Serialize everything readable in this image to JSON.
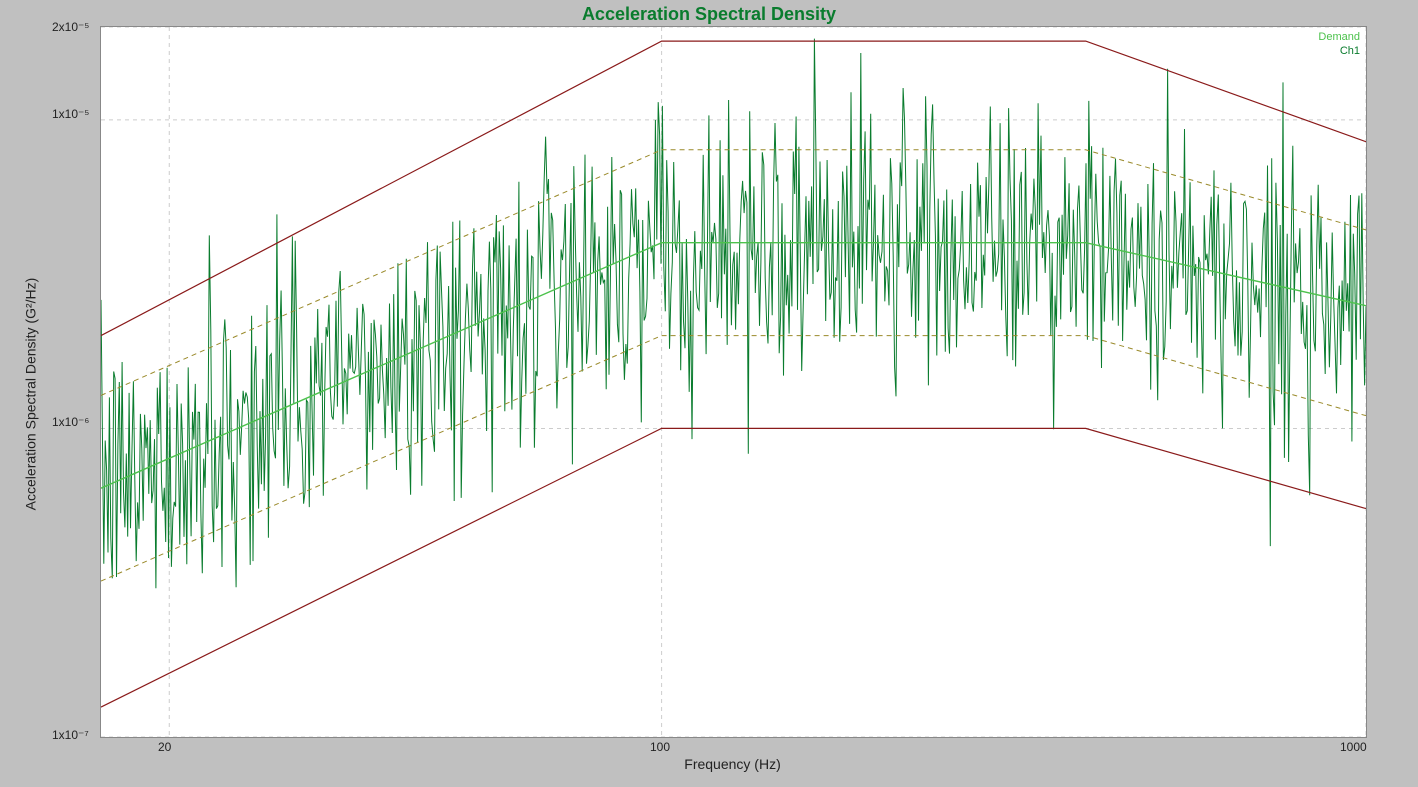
{
  "chart_data": {
    "type": "line",
    "title": "Acceleration Spectral Density",
    "xlabel": "Frequency (Hz)",
    "ylabel": "Acceleration Spectral Density (G²/Hz)",
    "x_scale": "log",
    "y_scale": "log",
    "xlim_hz": [
      16,
      1000
    ],
    "ylim_g2hz": [
      1e-07,
      2e-05
    ],
    "x_ticks": [
      20,
      100,
      1000
    ],
    "y_ticks": [
      1e-07,
      1e-06,
      1e-05,
      2e-05
    ],
    "y_tick_labels": [
      "1x10⁻⁷",
      "1x10⁻⁶",
      "1x10⁻⁵",
      "2x10⁻⁵"
    ],
    "legend": [
      "Demand",
      "Ch1"
    ],
    "legend_colors": [
      "#4cc24c",
      "#0a7c2e"
    ],
    "profile": {
      "demand": [
        {
          "hz": 16,
          "g2hz": 6.4e-07
        },
        {
          "hz": 100,
          "g2hz": 4e-06
        },
        {
          "hz": 400,
          "g2hz": 4e-06
        },
        {
          "hz": 1000,
          "g2hz": 2.5e-06
        }
      ],
      "alarm_upper": [
        {
          "hz": 16,
          "g2hz": 1.28e-06
        },
        {
          "hz": 100,
          "g2hz": 8e-06
        },
        {
          "hz": 400,
          "g2hz": 8e-06
        },
        {
          "hz": 1000,
          "g2hz": 4.4e-06
        }
      ],
      "alarm_lower": [
        {
          "hz": 16,
          "g2hz": 3.2e-07
        },
        {
          "hz": 100,
          "g2hz": 2e-06
        },
        {
          "hz": 400,
          "g2hz": 2e-06
        },
        {
          "hz": 1000,
          "g2hz": 1.1e-06
        }
      ],
      "abort_upper": [
        {
          "hz": 16,
          "g2hz": 2e-06
        },
        {
          "hz": 100,
          "g2hz": 1.8e-05
        },
        {
          "hz": 400,
          "g2hz": 1.8e-05
        },
        {
          "hz": 1000,
          "g2hz": 8.5e-06
        }
      ],
      "abort_lower": [
        {
          "hz": 16,
          "g2hz": 1.25e-07
        },
        {
          "hz": 100,
          "g2hz": 1e-06
        },
        {
          "hz": 400,
          "g2hz": 1e-06
        },
        {
          "hz": 1000,
          "g2hz": 5.5e-07
        }
      ]
    },
    "ch1_note": "Ch1 is a dense noisy PSD trace roughly following the Demand profile; individual sample values are randomly distributed around Demand within the alarm band. Representative envelope: ~3e-7..1.3e-6 near 16Hz rising to ~1e-6..9e-6 in the 100-1000Hz band with occasional spikes up to ~1.3e-5.",
    "ch1_noise": {
      "n_points": 900,
      "sigma_log10": 0.22,
      "seed": 12345
    }
  }
}
